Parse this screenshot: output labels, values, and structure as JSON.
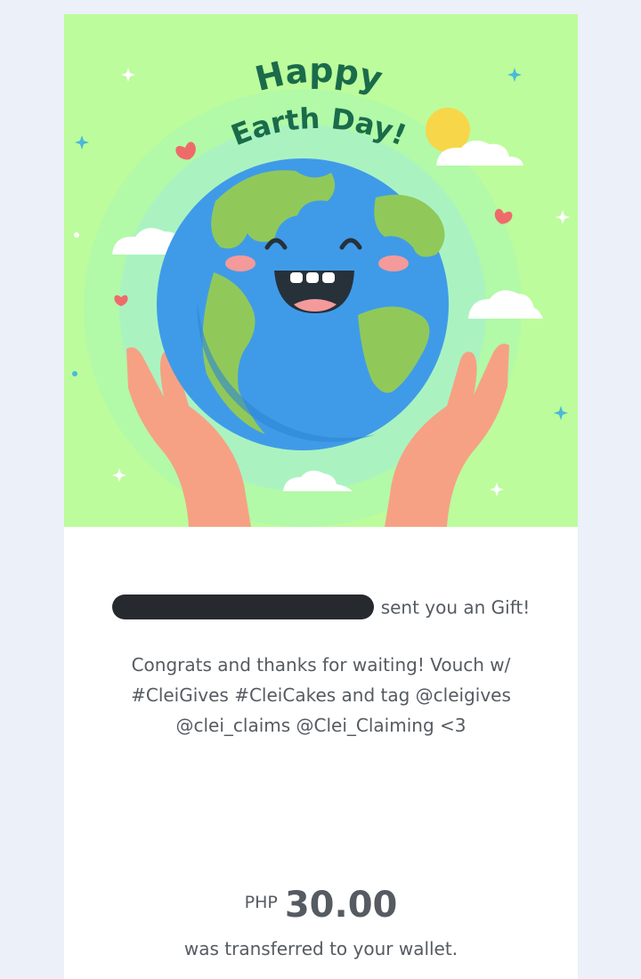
{
  "banner": {
    "headline_line1": "Happy",
    "headline_line2": "Earth Day!",
    "colors": {
      "background": "#bcfc9c",
      "ocean": "#3f9be8",
      "land": "#90c95a",
      "hands": "#f6a184",
      "headline": "#1a6b4a",
      "heart": "#ef6b6b",
      "sun": "#f7d64a"
    },
    "icons": [
      "earth-globe-icon",
      "hand-icon",
      "heart-icon",
      "cloud-icon",
      "sun-icon",
      "sparkle-icon"
    ]
  },
  "gift": {
    "sender_redacted": true,
    "sender_suffix": "sent you an Gift!",
    "message": "Congrats and thanks for waiting! Vouch w/ #CleiGives #CleiCakes and tag @cleigives @clei_claims @Clei_Claiming <3",
    "currency": "PHP",
    "amount": "30.00",
    "transfer_note": "was transferred to your wallet."
  }
}
